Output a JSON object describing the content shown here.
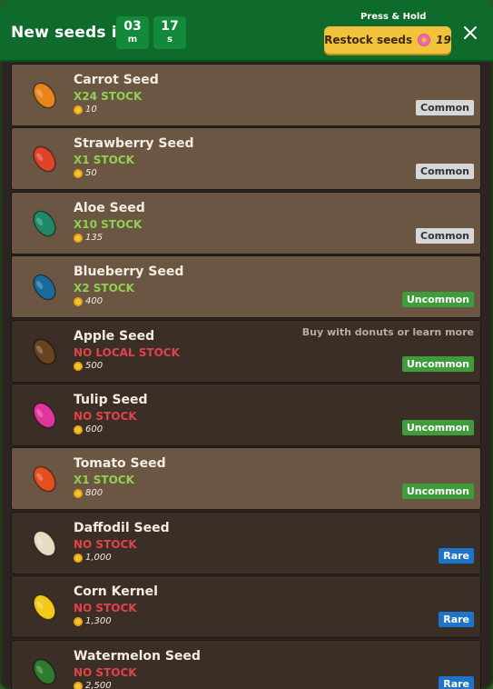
{
  "header": {
    "title": "New seeds in",
    "timer": {
      "minutes": "03",
      "minutes_unit": "m",
      "seconds": "17",
      "seconds_unit": "s"
    },
    "press_hold": "Press & Hold",
    "restock_label": "Restock seeds",
    "restock_cost": "19"
  },
  "seeds": [
    {
      "name": "Carrot Seed",
      "stock": "X24 STOCK",
      "price": "10",
      "rarity": "Common",
      "in_stock": true,
      "color": "#e8861d"
    },
    {
      "name": "Strawberry Seed",
      "stock": "X1 STOCK",
      "price": "50",
      "rarity": "Common",
      "in_stock": true,
      "color": "#e0432a"
    },
    {
      "name": "Aloe Seed",
      "stock": "X10 STOCK",
      "price": "135",
      "rarity": "Common",
      "in_stock": true,
      "color": "#1f8a6a"
    },
    {
      "name": "Blueberry Seed",
      "stock": "X2 STOCK",
      "price": "400",
      "rarity": "Uncommon",
      "in_stock": true,
      "color": "#1b6b9a"
    },
    {
      "name": "Apple Seed",
      "stock": "NO LOCAL STOCK",
      "price": "500",
      "rarity": "Uncommon",
      "in_stock": false,
      "color": "#6a4420",
      "hint": "Buy with donuts or learn more"
    },
    {
      "name": "Tulip Seed",
      "stock": "NO STOCK",
      "price": "600",
      "rarity": "Uncommon",
      "in_stock": false,
      "color": "#e0359c"
    },
    {
      "name": "Tomato Seed",
      "stock": "X1 STOCK",
      "price": "800",
      "rarity": "Uncommon",
      "in_stock": true,
      "color": "#e44f1e"
    },
    {
      "name": "Daffodil Seed",
      "stock": "NO STOCK",
      "price": "1,000",
      "rarity": "Rare",
      "in_stock": false,
      "color": "#e8dcc0"
    },
    {
      "name": "Corn Kernel",
      "stock": "NO STOCK",
      "price": "1,300",
      "rarity": "Rare",
      "in_stock": false,
      "color": "#f2c91a"
    },
    {
      "name": "Watermelon Seed",
      "stock": "NO STOCK",
      "price": "2,500",
      "rarity": "Rare",
      "in_stock": false,
      "color": "#2f7a2c"
    }
  ]
}
